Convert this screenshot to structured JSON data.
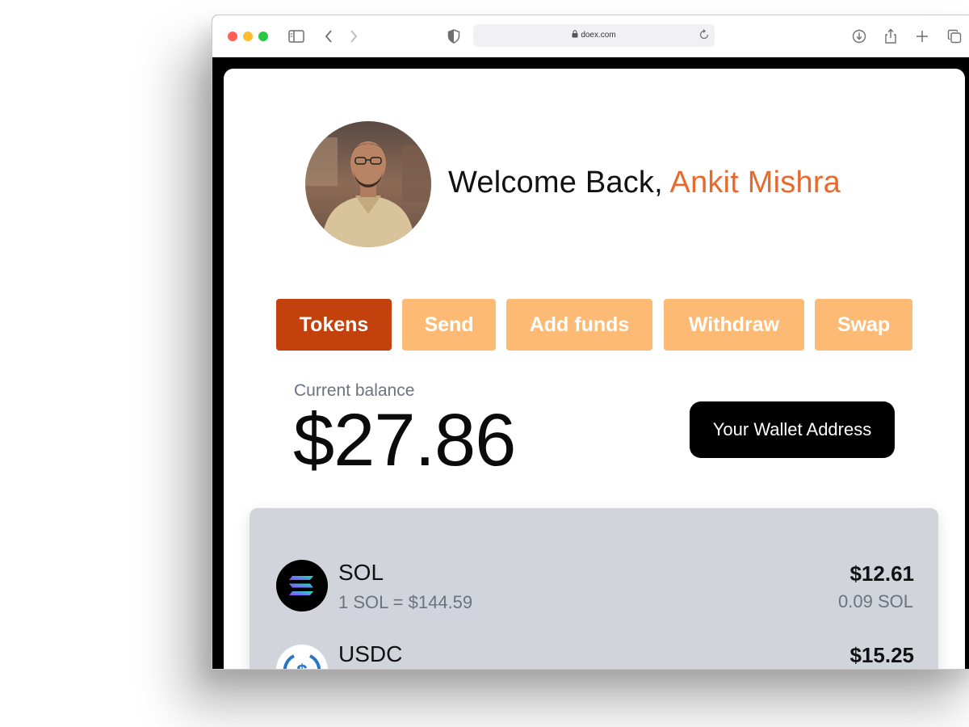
{
  "browser": {
    "url": "doex.com"
  },
  "welcome": {
    "prefix": "Welcome Back, ",
    "name": "Ankit Mishra",
    "name_color": "#e8692c"
  },
  "tabs": [
    {
      "label": "Tokens",
      "active": true
    },
    {
      "label": "Send",
      "active": false
    },
    {
      "label": "Add funds",
      "active": false
    },
    {
      "label": "Withdraw",
      "active": false
    },
    {
      "label": "Swap",
      "active": false
    }
  ],
  "balance": {
    "label": "Current balance",
    "amount": "$27.86"
  },
  "wallet_button": {
    "label": "Your Wallet Address"
  },
  "tokens": [
    {
      "symbol": "SOL",
      "rate": "1 SOL = $144.59",
      "usd": "$12.61",
      "quantity": "0.09 SOL",
      "icon": "solana-logo-icon"
    },
    {
      "symbol": "USDC",
      "usd": "$15.25",
      "icon": "usdc-logo-icon"
    }
  ],
  "colors": {
    "tab_active": "#c2410c",
    "tab_inactive": "#fdba74",
    "panel": "#d1d5db"
  }
}
